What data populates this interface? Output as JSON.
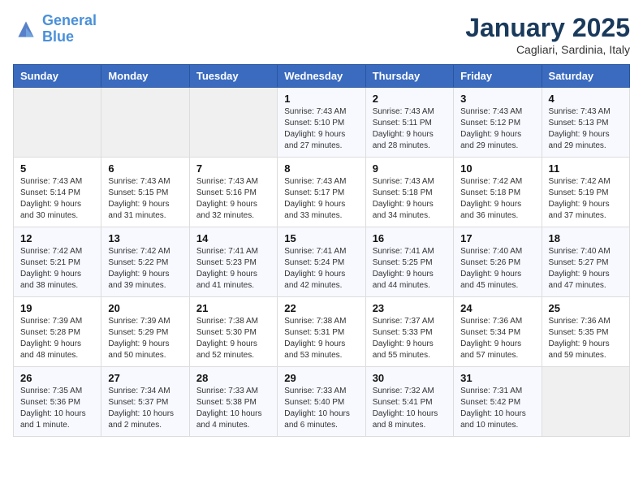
{
  "header": {
    "logo_line1": "General",
    "logo_line2": "Blue",
    "month": "January 2025",
    "location": "Cagliari, Sardinia, Italy"
  },
  "days_of_week": [
    "Sunday",
    "Monday",
    "Tuesday",
    "Wednesday",
    "Thursday",
    "Friday",
    "Saturday"
  ],
  "weeks": [
    [
      {
        "day": "",
        "info": ""
      },
      {
        "day": "",
        "info": ""
      },
      {
        "day": "",
        "info": ""
      },
      {
        "day": "1",
        "info": "Sunrise: 7:43 AM\nSunset: 5:10 PM\nDaylight: 9 hours and 27 minutes."
      },
      {
        "day": "2",
        "info": "Sunrise: 7:43 AM\nSunset: 5:11 PM\nDaylight: 9 hours and 28 minutes."
      },
      {
        "day": "3",
        "info": "Sunrise: 7:43 AM\nSunset: 5:12 PM\nDaylight: 9 hours and 29 minutes."
      },
      {
        "day": "4",
        "info": "Sunrise: 7:43 AM\nSunset: 5:13 PM\nDaylight: 9 hours and 29 minutes."
      }
    ],
    [
      {
        "day": "5",
        "info": "Sunrise: 7:43 AM\nSunset: 5:14 PM\nDaylight: 9 hours and 30 minutes."
      },
      {
        "day": "6",
        "info": "Sunrise: 7:43 AM\nSunset: 5:15 PM\nDaylight: 9 hours and 31 minutes."
      },
      {
        "day": "7",
        "info": "Sunrise: 7:43 AM\nSunset: 5:16 PM\nDaylight: 9 hours and 32 minutes."
      },
      {
        "day": "8",
        "info": "Sunrise: 7:43 AM\nSunset: 5:17 PM\nDaylight: 9 hours and 33 minutes."
      },
      {
        "day": "9",
        "info": "Sunrise: 7:43 AM\nSunset: 5:18 PM\nDaylight: 9 hours and 34 minutes."
      },
      {
        "day": "10",
        "info": "Sunrise: 7:42 AM\nSunset: 5:18 PM\nDaylight: 9 hours and 36 minutes."
      },
      {
        "day": "11",
        "info": "Sunrise: 7:42 AM\nSunset: 5:19 PM\nDaylight: 9 hours and 37 minutes."
      }
    ],
    [
      {
        "day": "12",
        "info": "Sunrise: 7:42 AM\nSunset: 5:21 PM\nDaylight: 9 hours and 38 minutes."
      },
      {
        "day": "13",
        "info": "Sunrise: 7:42 AM\nSunset: 5:22 PM\nDaylight: 9 hours and 39 minutes."
      },
      {
        "day": "14",
        "info": "Sunrise: 7:41 AM\nSunset: 5:23 PM\nDaylight: 9 hours and 41 minutes."
      },
      {
        "day": "15",
        "info": "Sunrise: 7:41 AM\nSunset: 5:24 PM\nDaylight: 9 hours and 42 minutes."
      },
      {
        "day": "16",
        "info": "Sunrise: 7:41 AM\nSunset: 5:25 PM\nDaylight: 9 hours and 44 minutes."
      },
      {
        "day": "17",
        "info": "Sunrise: 7:40 AM\nSunset: 5:26 PM\nDaylight: 9 hours and 45 minutes."
      },
      {
        "day": "18",
        "info": "Sunrise: 7:40 AM\nSunset: 5:27 PM\nDaylight: 9 hours and 47 minutes."
      }
    ],
    [
      {
        "day": "19",
        "info": "Sunrise: 7:39 AM\nSunset: 5:28 PM\nDaylight: 9 hours and 48 minutes."
      },
      {
        "day": "20",
        "info": "Sunrise: 7:39 AM\nSunset: 5:29 PM\nDaylight: 9 hours and 50 minutes."
      },
      {
        "day": "21",
        "info": "Sunrise: 7:38 AM\nSunset: 5:30 PM\nDaylight: 9 hours and 52 minutes."
      },
      {
        "day": "22",
        "info": "Sunrise: 7:38 AM\nSunset: 5:31 PM\nDaylight: 9 hours and 53 minutes."
      },
      {
        "day": "23",
        "info": "Sunrise: 7:37 AM\nSunset: 5:33 PM\nDaylight: 9 hours and 55 minutes."
      },
      {
        "day": "24",
        "info": "Sunrise: 7:36 AM\nSunset: 5:34 PM\nDaylight: 9 hours and 57 minutes."
      },
      {
        "day": "25",
        "info": "Sunrise: 7:36 AM\nSunset: 5:35 PM\nDaylight: 9 hours and 59 minutes."
      }
    ],
    [
      {
        "day": "26",
        "info": "Sunrise: 7:35 AM\nSunset: 5:36 PM\nDaylight: 10 hours and 1 minute."
      },
      {
        "day": "27",
        "info": "Sunrise: 7:34 AM\nSunset: 5:37 PM\nDaylight: 10 hours and 2 minutes."
      },
      {
        "day": "28",
        "info": "Sunrise: 7:33 AM\nSunset: 5:38 PM\nDaylight: 10 hours and 4 minutes."
      },
      {
        "day": "29",
        "info": "Sunrise: 7:33 AM\nSunset: 5:40 PM\nDaylight: 10 hours and 6 minutes."
      },
      {
        "day": "30",
        "info": "Sunrise: 7:32 AM\nSunset: 5:41 PM\nDaylight: 10 hours and 8 minutes."
      },
      {
        "day": "31",
        "info": "Sunrise: 7:31 AM\nSunset: 5:42 PM\nDaylight: 10 hours and 10 minutes."
      },
      {
        "day": "",
        "info": ""
      }
    ]
  ]
}
